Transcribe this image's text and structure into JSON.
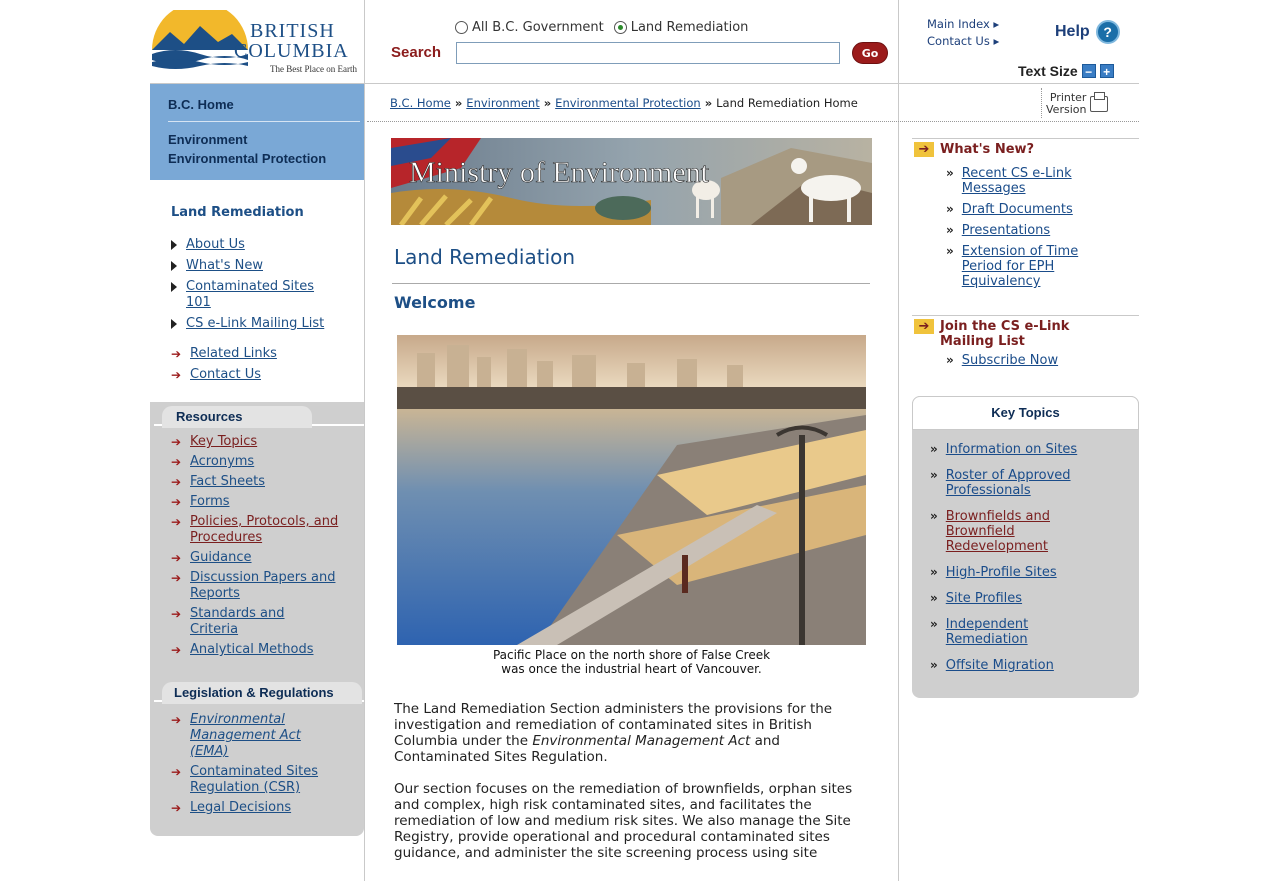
{
  "header": {
    "logo_line1": "BRITISH",
    "logo_line2": "COLUMBIA",
    "logo_tagline": "The Best Place on Earth",
    "search_scope_1": "All B.C. Government",
    "search_scope_2": "Land Remediation",
    "search_scope_selected": "Land Remediation",
    "search_label": "Search",
    "search_value": "",
    "go_label": "Go",
    "main_index": "Main Index ▸",
    "contact_us": "Contact Us ▸",
    "help_label": "Help",
    "text_size_label": "Text Size"
  },
  "breadcrumb": {
    "items": [
      "B.C. Home",
      "Environment",
      "Environmental Protection",
      "Land Remediation Home"
    ],
    "separator": "»",
    "printer_line1": "Printer",
    "printer_line2": "Version"
  },
  "left_nav": {
    "home": "B.C. Home",
    "section_line1": "Environment",
    "section_line2": "Environmental Protection",
    "heading": "Land Remediation",
    "items": [
      "About Us",
      "What's New",
      "Contaminated Sites 101",
      "CS e-Link Mailing List"
    ],
    "links": [
      "Related Links",
      "Contact Us"
    ],
    "resources_heading": "Resources",
    "resources": [
      "Key Topics",
      "Acronyms",
      "Fact Sheets",
      "Forms",
      "Policies, Protocols, and Procedures",
      "Guidance",
      "Discussion Papers and Reports",
      "Standards and Criteria",
      "Analytical Methods"
    ],
    "legislation_heading": "Legislation & Regulations",
    "legislation": [
      "Environmental Management Act (EMA)",
      "Contaminated Sites Regulation (CSR)",
      "Legal Decisions"
    ]
  },
  "main": {
    "banner_text": "Ministry of Environment",
    "title": "Land Remediation",
    "subtitle": "Welcome",
    "caption_line1": "Pacific Place on the north shore of False Creek",
    "caption_line2": "was once the industrial heart of Vancouver.",
    "para1_a": "The Land Remediation Section administers the provisions for the investigation and remediation of contaminated sites in British Columbia under the ",
    "para1_em": "Environmental Management Act",
    "para1_b": " and Contaminated Sites Regulation.",
    "para2": "Our section focuses on the remediation of brownfields, orphan sites and complex, high risk contaminated sites, and facilitates the remediation of low and medium risk sites. We also manage the Site Registry, provide operational and procedural contaminated sites guidance, and administer the site screening process using site"
  },
  "right": {
    "whats_new_heading": "What's New?",
    "whats_new": [
      "Recent CS e-Link Messages",
      "Draft Documents",
      "Presentations",
      "Extension of Time Period for EPH Equivalency"
    ],
    "join_heading": "Join the CS e-Link Mailing List",
    "subscribe": "Subscribe Now",
    "key_topics_heading": "Key Topics",
    "key_topics": [
      "Information on Sites",
      "Roster of Approved Professionals",
      "Brownfields and Brownfield Redevelopment",
      "High-Profile Sites",
      "Site Profiles",
      "Independent Remediation",
      "Offsite Migration"
    ]
  },
  "icons": {
    "radio": "radio-icon",
    "help": "help-icon",
    "text_size": "plus-minus-icons",
    "printer": "printer-icon",
    "arrow": "arrow-icon",
    "triangle": "triangle-bullet-icon"
  },
  "colors": {
    "nav_blue": "#7aa8d6",
    "link_blue": "#1d4f86",
    "dark_red": "#9b1b1b",
    "panel_grey": "#cfcfcf",
    "accent_yellow": "#f0c33c"
  }
}
